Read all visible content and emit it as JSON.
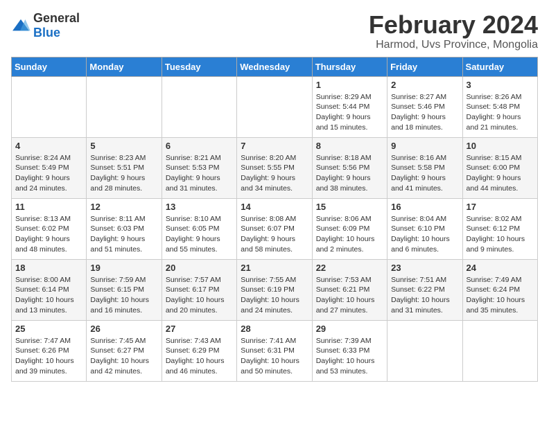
{
  "logo": {
    "general": "General",
    "blue": "Blue"
  },
  "header": {
    "month": "February 2024",
    "location": "Harmod, Uvs Province, Mongolia"
  },
  "weekdays": [
    "Sunday",
    "Monday",
    "Tuesday",
    "Wednesday",
    "Thursday",
    "Friday",
    "Saturday"
  ],
  "weeks": [
    [
      {
        "day": "",
        "content": ""
      },
      {
        "day": "",
        "content": ""
      },
      {
        "day": "",
        "content": ""
      },
      {
        "day": "",
        "content": ""
      },
      {
        "day": "1",
        "content": "Sunrise: 8:29 AM\nSunset: 5:44 PM\nDaylight: 9 hours\nand 15 minutes."
      },
      {
        "day": "2",
        "content": "Sunrise: 8:27 AM\nSunset: 5:46 PM\nDaylight: 9 hours\nand 18 minutes."
      },
      {
        "day": "3",
        "content": "Sunrise: 8:26 AM\nSunset: 5:48 PM\nDaylight: 9 hours\nand 21 minutes."
      }
    ],
    [
      {
        "day": "4",
        "content": "Sunrise: 8:24 AM\nSunset: 5:49 PM\nDaylight: 9 hours\nand 24 minutes."
      },
      {
        "day": "5",
        "content": "Sunrise: 8:23 AM\nSunset: 5:51 PM\nDaylight: 9 hours\nand 28 minutes."
      },
      {
        "day": "6",
        "content": "Sunrise: 8:21 AM\nSunset: 5:53 PM\nDaylight: 9 hours\nand 31 minutes."
      },
      {
        "day": "7",
        "content": "Sunrise: 8:20 AM\nSunset: 5:55 PM\nDaylight: 9 hours\nand 34 minutes."
      },
      {
        "day": "8",
        "content": "Sunrise: 8:18 AM\nSunset: 5:56 PM\nDaylight: 9 hours\nand 38 minutes."
      },
      {
        "day": "9",
        "content": "Sunrise: 8:16 AM\nSunset: 5:58 PM\nDaylight: 9 hours\nand 41 minutes."
      },
      {
        "day": "10",
        "content": "Sunrise: 8:15 AM\nSunset: 6:00 PM\nDaylight: 9 hours\nand 44 minutes."
      }
    ],
    [
      {
        "day": "11",
        "content": "Sunrise: 8:13 AM\nSunset: 6:02 PM\nDaylight: 9 hours\nand 48 minutes."
      },
      {
        "day": "12",
        "content": "Sunrise: 8:11 AM\nSunset: 6:03 PM\nDaylight: 9 hours\nand 51 minutes."
      },
      {
        "day": "13",
        "content": "Sunrise: 8:10 AM\nSunset: 6:05 PM\nDaylight: 9 hours\nand 55 minutes."
      },
      {
        "day": "14",
        "content": "Sunrise: 8:08 AM\nSunset: 6:07 PM\nDaylight: 9 hours\nand 58 minutes."
      },
      {
        "day": "15",
        "content": "Sunrise: 8:06 AM\nSunset: 6:09 PM\nDaylight: 10 hours\nand 2 minutes."
      },
      {
        "day": "16",
        "content": "Sunrise: 8:04 AM\nSunset: 6:10 PM\nDaylight: 10 hours\nand 6 minutes."
      },
      {
        "day": "17",
        "content": "Sunrise: 8:02 AM\nSunset: 6:12 PM\nDaylight: 10 hours\nand 9 minutes."
      }
    ],
    [
      {
        "day": "18",
        "content": "Sunrise: 8:00 AM\nSunset: 6:14 PM\nDaylight: 10 hours\nand 13 minutes."
      },
      {
        "day": "19",
        "content": "Sunrise: 7:59 AM\nSunset: 6:15 PM\nDaylight: 10 hours\nand 16 minutes."
      },
      {
        "day": "20",
        "content": "Sunrise: 7:57 AM\nSunset: 6:17 PM\nDaylight: 10 hours\nand 20 minutes."
      },
      {
        "day": "21",
        "content": "Sunrise: 7:55 AM\nSunset: 6:19 PM\nDaylight: 10 hours\nand 24 minutes."
      },
      {
        "day": "22",
        "content": "Sunrise: 7:53 AM\nSunset: 6:21 PM\nDaylight: 10 hours\nand 27 minutes."
      },
      {
        "day": "23",
        "content": "Sunrise: 7:51 AM\nSunset: 6:22 PM\nDaylight: 10 hours\nand 31 minutes."
      },
      {
        "day": "24",
        "content": "Sunrise: 7:49 AM\nSunset: 6:24 PM\nDaylight: 10 hours\nand 35 minutes."
      }
    ],
    [
      {
        "day": "25",
        "content": "Sunrise: 7:47 AM\nSunset: 6:26 PM\nDaylight: 10 hours\nand 39 minutes."
      },
      {
        "day": "26",
        "content": "Sunrise: 7:45 AM\nSunset: 6:27 PM\nDaylight: 10 hours\nand 42 minutes."
      },
      {
        "day": "27",
        "content": "Sunrise: 7:43 AM\nSunset: 6:29 PM\nDaylight: 10 hours\nand 46 minutes."
      },
      {
        "day": "28",
        "content": "Sunrise: 7:41 AM\nSunset: 6:31 PM\nDaylight: 10 hours\nand 50 minutes."
      },
      {
        "day": "29",
        "content": "Sunrise: 7:39 AM\nSunset: 6:33 PM\nDaylight: 10 hours\nand 53 minutes."
      },
      {
        "day": "",
        "content": ""
      },
      {
        "day": "",
        "content": ""
      }
    ]
  ]
}
